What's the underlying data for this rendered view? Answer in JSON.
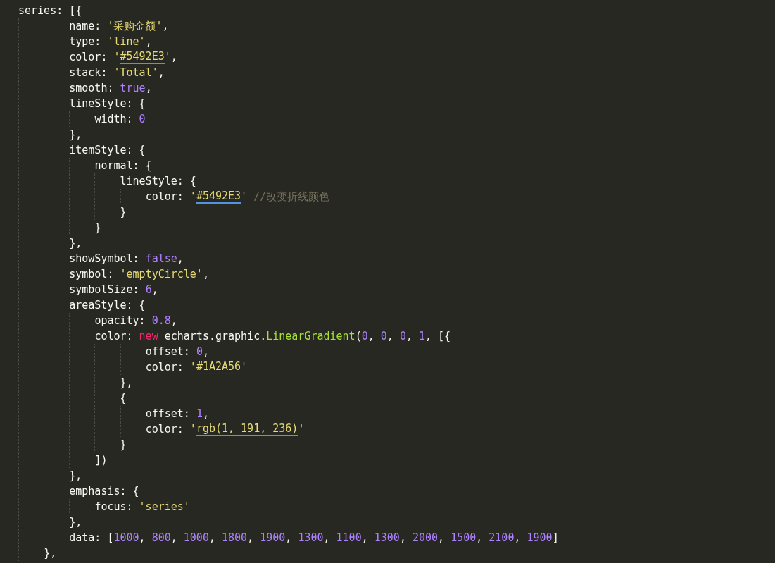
{
  "editor": {
    "lines": [
      {
        "tokens": [
          {
            "t": "series: [{",
            "kind": "plain"
          }
        ],
        "children": [
          {
            "hang": true,
            "tokens": [
              {
                "t": "name: ",
                "kind": "plain"
              },
              {
                "t": "'采购金额'",
                "kind": "string"
              },
              {
                "t": ",",
                "kind": "plain"
              }
            ]
          },
          {
            "hang": true,
            "tokens": [
              {
                "t": "type: ",
                "kind": "plain"
              },
              {
                "t": "'line'",
                "kind": "string"
              },
              {
                "t": ",",
                "kind": "plain"
              }
            ]
          },
          {
            "hang": true,
            "tokens": [
              {
                "t": "color: ",
                "kind": "plain"
              },
              {
                "t": "'",
                "kind": "string"
              },
              {
                "t": "#5492E3",
                "kind": "swatch",
                "color": "#5492e3"
              },
              {
                "t": "'",
                "kind": "string"
              },
              {
                "t": ",",
                "kind": "plain"
              }
            ]
          },
          {
            "hang": true,
            "tokens": [
              {
                "t": "stack: ",
                "kind": "plain"
              },
              {
                "t": "'Total'",
                "kind": "string"
              },
              {
                "t": ",",
                "kind": "plain"
              }
            ]
          },
          {
            "hang": true,
            "tokens": [
              {
                "t": "smooth: ",
                "kind": "plain"
              },
              {
                "t": "true",
                "kind": "literal"
              },
              {
                "t": ",",
                "kind": "plain"
              }
            ]
          },
          {
            "hang": true,
            "tokens": [
              {
                "t": "lineStyle: {",
                "kind": "plain"
              }
            ],
            "children": [
              {
                "tokens": [
                  {
                    "t": "width: ",
                    "kind": "plain"
                  },
                  {
                    "t": "0",
                    "kind": "literal"
                  }
                ]
              }
            ]
          },
          {
            "hang": true,
            "tokens": [
              {
                "t": "},",
                "kind": "plain"
              }
            ]
          },
          {
            "hang": true,
            "tokens": [
              {
                "t": "itemStyle: {",
                "kind": "plain"
              }
            ],
            "children": [
              {
                "tokens": [
                  {
                    "t": "normal: {",
                    "kind": "plain"
                  }
                ],
                "children": [
                  {
                    "tokens": [
                      {
                        "t": "lineStyle: {",
                        "kind": "plain"
                      }
                    ],
                    "children": [
                      {
                        "tokens": [
                          {
                            "t": "color: ",
                            "kind": "plain"
                          },
                          {
                            "t": "'",
                            "kind": "string"
                          },
                          {
                            "t": "#5492E3",
                            "kind": "swatch",
                            "color": "#5492e3"
                          },
                          {
                            "t": "'",
                            "kind": "string"
                          },
                          {
                            "t": " //改变折线颜色",
                            "kind": "comment"
                          }
                        ]
                      }
                    ]
                  },
                  {
                    "tokens": [
                      {
                        "t": "}",
                        "kind": "plain"
                      }
                    ]
                  }
                ]
              },
              {
                "tokens": [
                  {
                    "t": "}",
                    "kind": "plain"
                  }
                ]
              }
            ]
          },
          {
            "hang": true,
            "tokens": [
              {
                "t": "},",
                "kind": "plain"
              }
            ]
          },
          {
            "hang": true,
            "tokens": [
              {
                "t": "showSymbol: ",
                "kind": "plain"
              },
              {
                "t": "false",
                "kind": "literal"
              },
              {
                "t": ",",
                "kind": "plain"
              }
            ]
          },
          {
            "hang": true,
            "tokens": [
              {
                "t": "symbol: ",
                "kind": "plain"
              },
              {
                "t": "'emptyCircle'",
                "kind": "string"
              },
              {
                "t": ",",
                "kind": "plain"
              }
            ]
          },
          {
            "hang": true,
            "tokens": [
              {
                "t": "symbolSize: ",
                "kind": "plain"
              },
              {
                "t": "6",
                "kind": "literal"
              },
              {
                "t": ",",
                "kind": "plain"
              }
            ]
          },
          {
            "hang": true,
            "tokens": [
              {
                "t": "areaStyle: {",
                "kind": "plain"
              }
            ],
            "children": [
              {
                "tokens": [
                  {
                    "t": "opacity: ",
                    "kind": "plain"
                  },
                  {
                    "t": "0.8",
                    "kind": "literal"
                  },
                  {
                    "t": ",",
                    "kind": "plain"
                  }
                ]
              },
              {
                "tokens": [
                  {
                    "t": "color: ",
                    "kind": "plain"
                  },
                  {
                    "t": "new",
                    "kind": "keyword"
                  },
                  {
                    "t": " echarts.graphic.",
                    "kind": "plain"
                  },
                  {
                    "t": "LinearGradient",
                    "kind": "function"
                  },
                  {
                    "t": "(",
                    "kind": "plain"
                  },
                  {
                    "t": "0",
                    "kind": "literal"
                  },
                  {
                    "t": ", ",
                    "kind": "plain"
                  },
                  {
                    "t": "0",
                    "kind": "literal"
                  },
                  {
                    "t": ", ",
                    "kind": "plain"
                  },
                  {
                    "t": "0",
                    "kind": "literal"
                  },
                  {
                    "t": ", ",
                    "kind": "plain"
                  },
                  {
                    "t": "1",
                    "kind": "literal"
                  },
                  {
                    "t": ", [{",
                    "kind": "plain"
                  }
                ],
                "children": [
                  {
                    "hang": true,
                    "tokens": [
                      {
                        "t": "offset: ",
                        "kind": "plain"
                      },
                      {
                        "t": "0",
                        "kind": "literal"
                      },
                      {
                        "t": ",",
                        "kind": "plain"
                      }
                    ]
                  },
                  {
                    "hang": true,
                    "tokens": [
                      {
                        "t": "color: ",
                        "kind": "plain"
                      },
                      {
                        "t": "'",
                        "kind": "string"
                      },
                      {
                        "t": "#1A2A56",
                        "kind": "swatch",
                        "color": "#1a2a56"
                      },
                      {
                        "t": "'",
                        "kind": "string"
                      }
                    ]
                  },
                  {
                    "tokens": [
                      {
                        "t": "},",
                        "kind": "plain"
                      }
                    ]
                  },
                  {
                    "tokens": [
                      {
                        "t": "{",
                        "kind": "plain"
                      }
                    ],
                    "children": [
                      {
                        "tokens": [
                          {
                            "t": "offset: ",
                            "kind": "plain"
                          },
                          {
                            "t": "1",
                            "kind": "literal"
                          },
                          {
                            "t": ",",
                            "kind": "plain"
                          }
                        ]
                      },
                      {
                        "tokens": [
                          {
                            "t": "color: ",
                            "kind": "plain"
                          },
                          {
                            "t": "'",
                            "kind": "string"
                          },
                          {
                            "t": "rgb(1, 191, 236)",
                            "kind": "swatch",
                            "color": "#01bfec"
                          },
                          {
                            "t": "'",
                            "kind": "string"
                          }
                        ]
                      }
                    ]
                  },
                  {
                    "tokens": [
                      {
                        "t": "}",
                        "kind": "plain"
                      }
                    ]
                  }
                ]
              },
              {
                "tokens": [
                  {
                    "t": "])",
                    "kind": "plain"
                  }
                ]
              }
            ]
          },
          {
            "hang": true,
            "tokens": [
              {
                "t": "},",
                "kind": "plain"
              }
            ]
          },
          {
            "hang": true,
            "tokens": [
              {
                "t": "emphasis: {",
                "kind": "plain"
              }
            ],
            "children": [
              {
                "tokens": [
                  {
                    "t": "focus: ",
                    "kind": "plain"
                  },
                  {
                    "t": "'series'",
                    "kind": "string"
                  }
                ]
              }
            ]
          },
          {
            "hang": true,
            "tokens": [
              {
                "t": "},",
                "kind": "plain"
              }
            ]
          },
          {
            "hang": true,
            "tokens": [
              {
                "t": "data: [",
                "kind": "plain"
              },
              {
                "t": "1000",
                "kind": "literal"
              },
              {
                "t": ", ",
                "kind": "plain"
              },
              {
                "t": "800",
                "kind": "literal"
              },
              {
                "t": ", ",
                "kind": "plain"
              },
              {
                "t": "1000",
                "kind": "literal"
              },
              {
                "t": ", ",
                "kind": "plain"
              },
              {
                "t": "1800",
                "kind": "literal"
              },
              {
                "t": ", ",
                "kind": "plain"
              },
              {
                "t": "1900",
                "kind": "literal"
              },
              {
                "t": ", ",
                "kind": "plain"
              },
              {
                "t": "1300",
                "kind": "literal"
              },
              {
                "t": ", ",
                "kind": "plain"
              },
              {
                "t": "1100",
                "kind": "literal"
              },
              {
                "t": ", ",
                "kind": "plain"
              },
              {
                "t": "1300",
                "kind": "literal"
              },
              {
                "t": ", ",
                "kind": "plain"
              },
              {
                "t": "2000",
                "kind": "literal"
              },
              {
                "t": ", ",
                "kind": "plain"
              },
              {
                "t": "1500",
                "kind": "literal"
              },
              {
                "t": ", ",
                "kind": "plain"
              },
              {
                "t": "2100",
                "kind": "literal"
              },
              {
                "t": ", ",
                "kind": "plain"
              },
              {
                "t": "1900",
                "kind": "literal"
              },
              {
                "t": "]",
                "kind": "plain"
              }
            ]
          },
          {
            "tokens": [
              {
                "t": "},",
                "kind": "plain"
              }
            ]
          }
        ]
      }
    ]
  }
}
